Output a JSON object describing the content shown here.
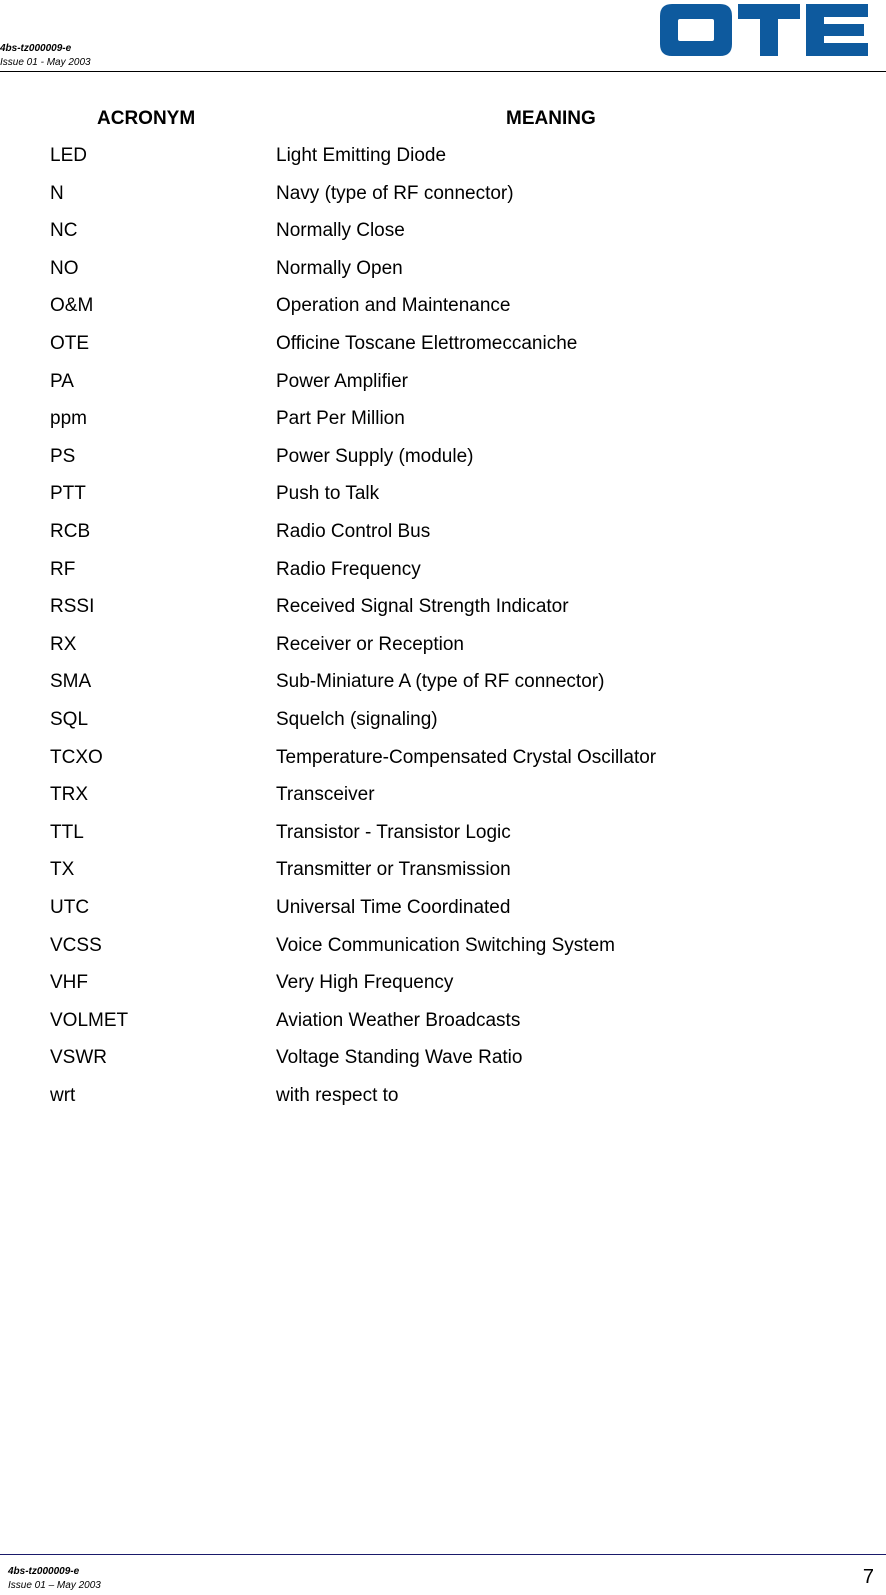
{
  "header": {
    "doc_code": "4bs-tz000009-e",
    "issue": "Issue 01 - May 2003",
    "logo_text": "OTE",
    "logo_color": "#0e5a9e"
  },
  "table": {
    "headers": {
      "acronym": "ACRONYM",
      "meaning": "MEANING"
    },
    "rows": [
      {
        "acronym": "LED",
        "meaning": "Light Emitting Diode"
      },
      {
        "acronym": "N",
        "meaning": "Navy (type of RF connector)"
      },
      {
        "acronym": "NC",
        "meaning": "Normally Close"
      },
      {
        "acronym": "NO",
        "meaning": "Normally Open"
      },
      {
        "acronym": "O&M",
        "meaning": "Operation and Maintenance"
      },
      {
        "acronym": "OTE",
        "meaning": "Officine Toscane Elettromeccaniche"
      },
      {
        "acronym": "PA",
        "meaning": "Power Amplifier"
      },
      {
        "acronym": "ppm",
        "meaning": "Part Per Million"
      },
      {
        "acronym": "PS",
        "meaning": "Power Supply (module)"
      },
      {
        "acronym": "PTT",
        "meaning": "Push to Talk"
      },
      {
        "acronym": "RCB",
        "meaning": "Radio Control Bus"
      },
      {
        "acronym": "RF",
        "meaning": "Radio Frequency"
      },
      {
        "acronym": "RSSI",
        "meaning": "Received Signal Strength Indicator"
      },
      {
        "acronym": "RX",
        "meaning": "Receiver or Reception"
      },
      {
        "acronym": "SMA",
        "meaning": "Sub-Miniature A (type of RF connector)"
      },
      {
        "acronym": "SQL",
        "meaning": "Squelch (signaling)"
      },
      {
        "acronym": "TCXO",
        "meaning": "Temperature-Compensated Crystal Oscillator"
      },
      {
        "acronym": "TRX",
        "meaning": "Transceiver"
      },
      {
        "acronym": "TTL",
        "meaning": "Transistor - Transistor Logic"
      },
      {
        "acronym": "TX",
        "meaning": "Transmitter or Transmission"
      },
      {
        "acronym": "UTC",
        "meaning": "Universal Time Coordinated"
      },
      {
        "acronym": "VCSS",
        "meaning": "Voice Communication Switching System"
      },
      {
        "acronym": "VHF",
        "meaning": "Very High Frequency"
      },
      {
        "acronym": "VOLMET",
        "meaning": "Aviation Weather Broadcasts"
      },
      {
        "acronym": "VSWR",
        "meaning": "Voltage Standing Wave Ratio"
      },
      {
        "acronym": "wrt",
        "meaning": "with respect to"
      }
    ]
  },
  "footer": {
    "doc_code": "4bs-tz000009-e",
    "issue": "Issue 01 – May 2003",
    "page_number": "7"
  }
}
